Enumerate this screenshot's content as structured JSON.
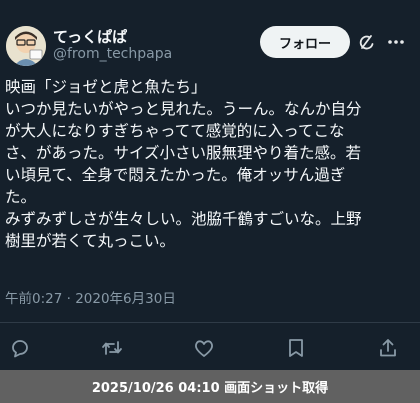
{
  "author": {
    "display_name": "てっくぱぱ",
    "handle": "@from_techpapa"
  },
  "follow_label": "フォロー",
  "tweet": {
    "lines": [
      "映画「ジョゼと虎と魚たち」",
      "いつか見たいがやっと見れた。うーん。なんか自分",
      "が大人になりすぎちゃってて感覚的に入ってこな",
      "さ、があった。サイズ小さい服無理やり着た感。若",
      "い頃見て、全身で悶えたかった。俺オッサん過ぎ",
      "た。",
      "みずみずしさが生々しい。池脇千鶴すごいな。上野",
      "樹里が若くて丸っこい。"
    ],
    "timestamp": "午前0:27 · 2020年6月30日"
  },
  "actions": [
    "reply-icon",
    "retweet-icon",
    "like-icon",
    "bookmark-icon",
    "share-icon"
  ],
  "footer": {
    "caption": "2025/10/26 04:10 画面ショット取得"
  },
  "colors": {
    "background": "#15202b",
    "secondary_text": "#8899a6",
    "follow_button_bg": "#eff3f4",
    "footer_bg": "#616161"
  }
}
